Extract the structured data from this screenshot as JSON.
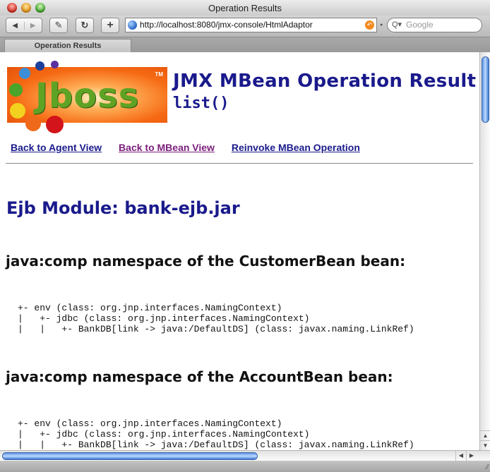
{
  "window": {
    "title": "Operation Results"
  },
  "toolbar": {
    "back_icon": "◀",
    "forward_icon": "▶",
    "edit_icon": "✎",
    "reload_icon": "↻",
    "add_icon": "+",
    "url": "http://localhost:8080/jmx-console/HtmlAdaptor",
    "snapback_icon": "↶",
    "search_placeholder": "Google",
    "search_icon": "Q▾"
  },
  "tabs": [
    {
      "label": "Operation Results",
      "active": true
    }
  ],
  "page": {
    "logo": {
      "text": "Jboss",
      "tm": "TM"
    },
    "heading": "JMX MBean Operation Result",
    "operation": "list()",
    "links": {
      "agent_view": "Back to Agent View",
      "mbean_view": "Back to MBean View",
      "reinvoke": "Reinvoke MBean Operation"
    },
    "module_title": "Ejb Module: bank-ejb.jar",
    "beans": [
      {
        "title": "java:comp namespace of the CustomerBean bean:",
        "tree": [
          "+- env (class: org.jnp.interfaces.NamingContext)",
          "|   +- jdbc (class: org.jnp.interfaces.NamingContext)",
          "|   |   +- BankDB[link -> java:/DefaultDS] (class: javax.naming.LinkRef)"
        ]
      },
      {
        "title": "java:comp namespace of the AccountBean bean:",
        "tree": [
          "+- env (class: org.jnp.interfaces.NamingContext)",
          "|   +- jdbc (class: org.jnp.interfaces.NamingContext)",
          "|   |   +- BankDB[link -> java:/DefaultDS] (class: javax.naming.LinkRef)"
        ]
      }
    ]
  },
  "scrollbars": {
    "up_icon": "▲",
    "down_icon": "▼",
    "left_icon": "◀",
    "right_icon": "▶"
  },
  "colors": {
    "heading_blue": "#1a1a8c",
    "visited_link": "#7b1e7b"
  }
}
